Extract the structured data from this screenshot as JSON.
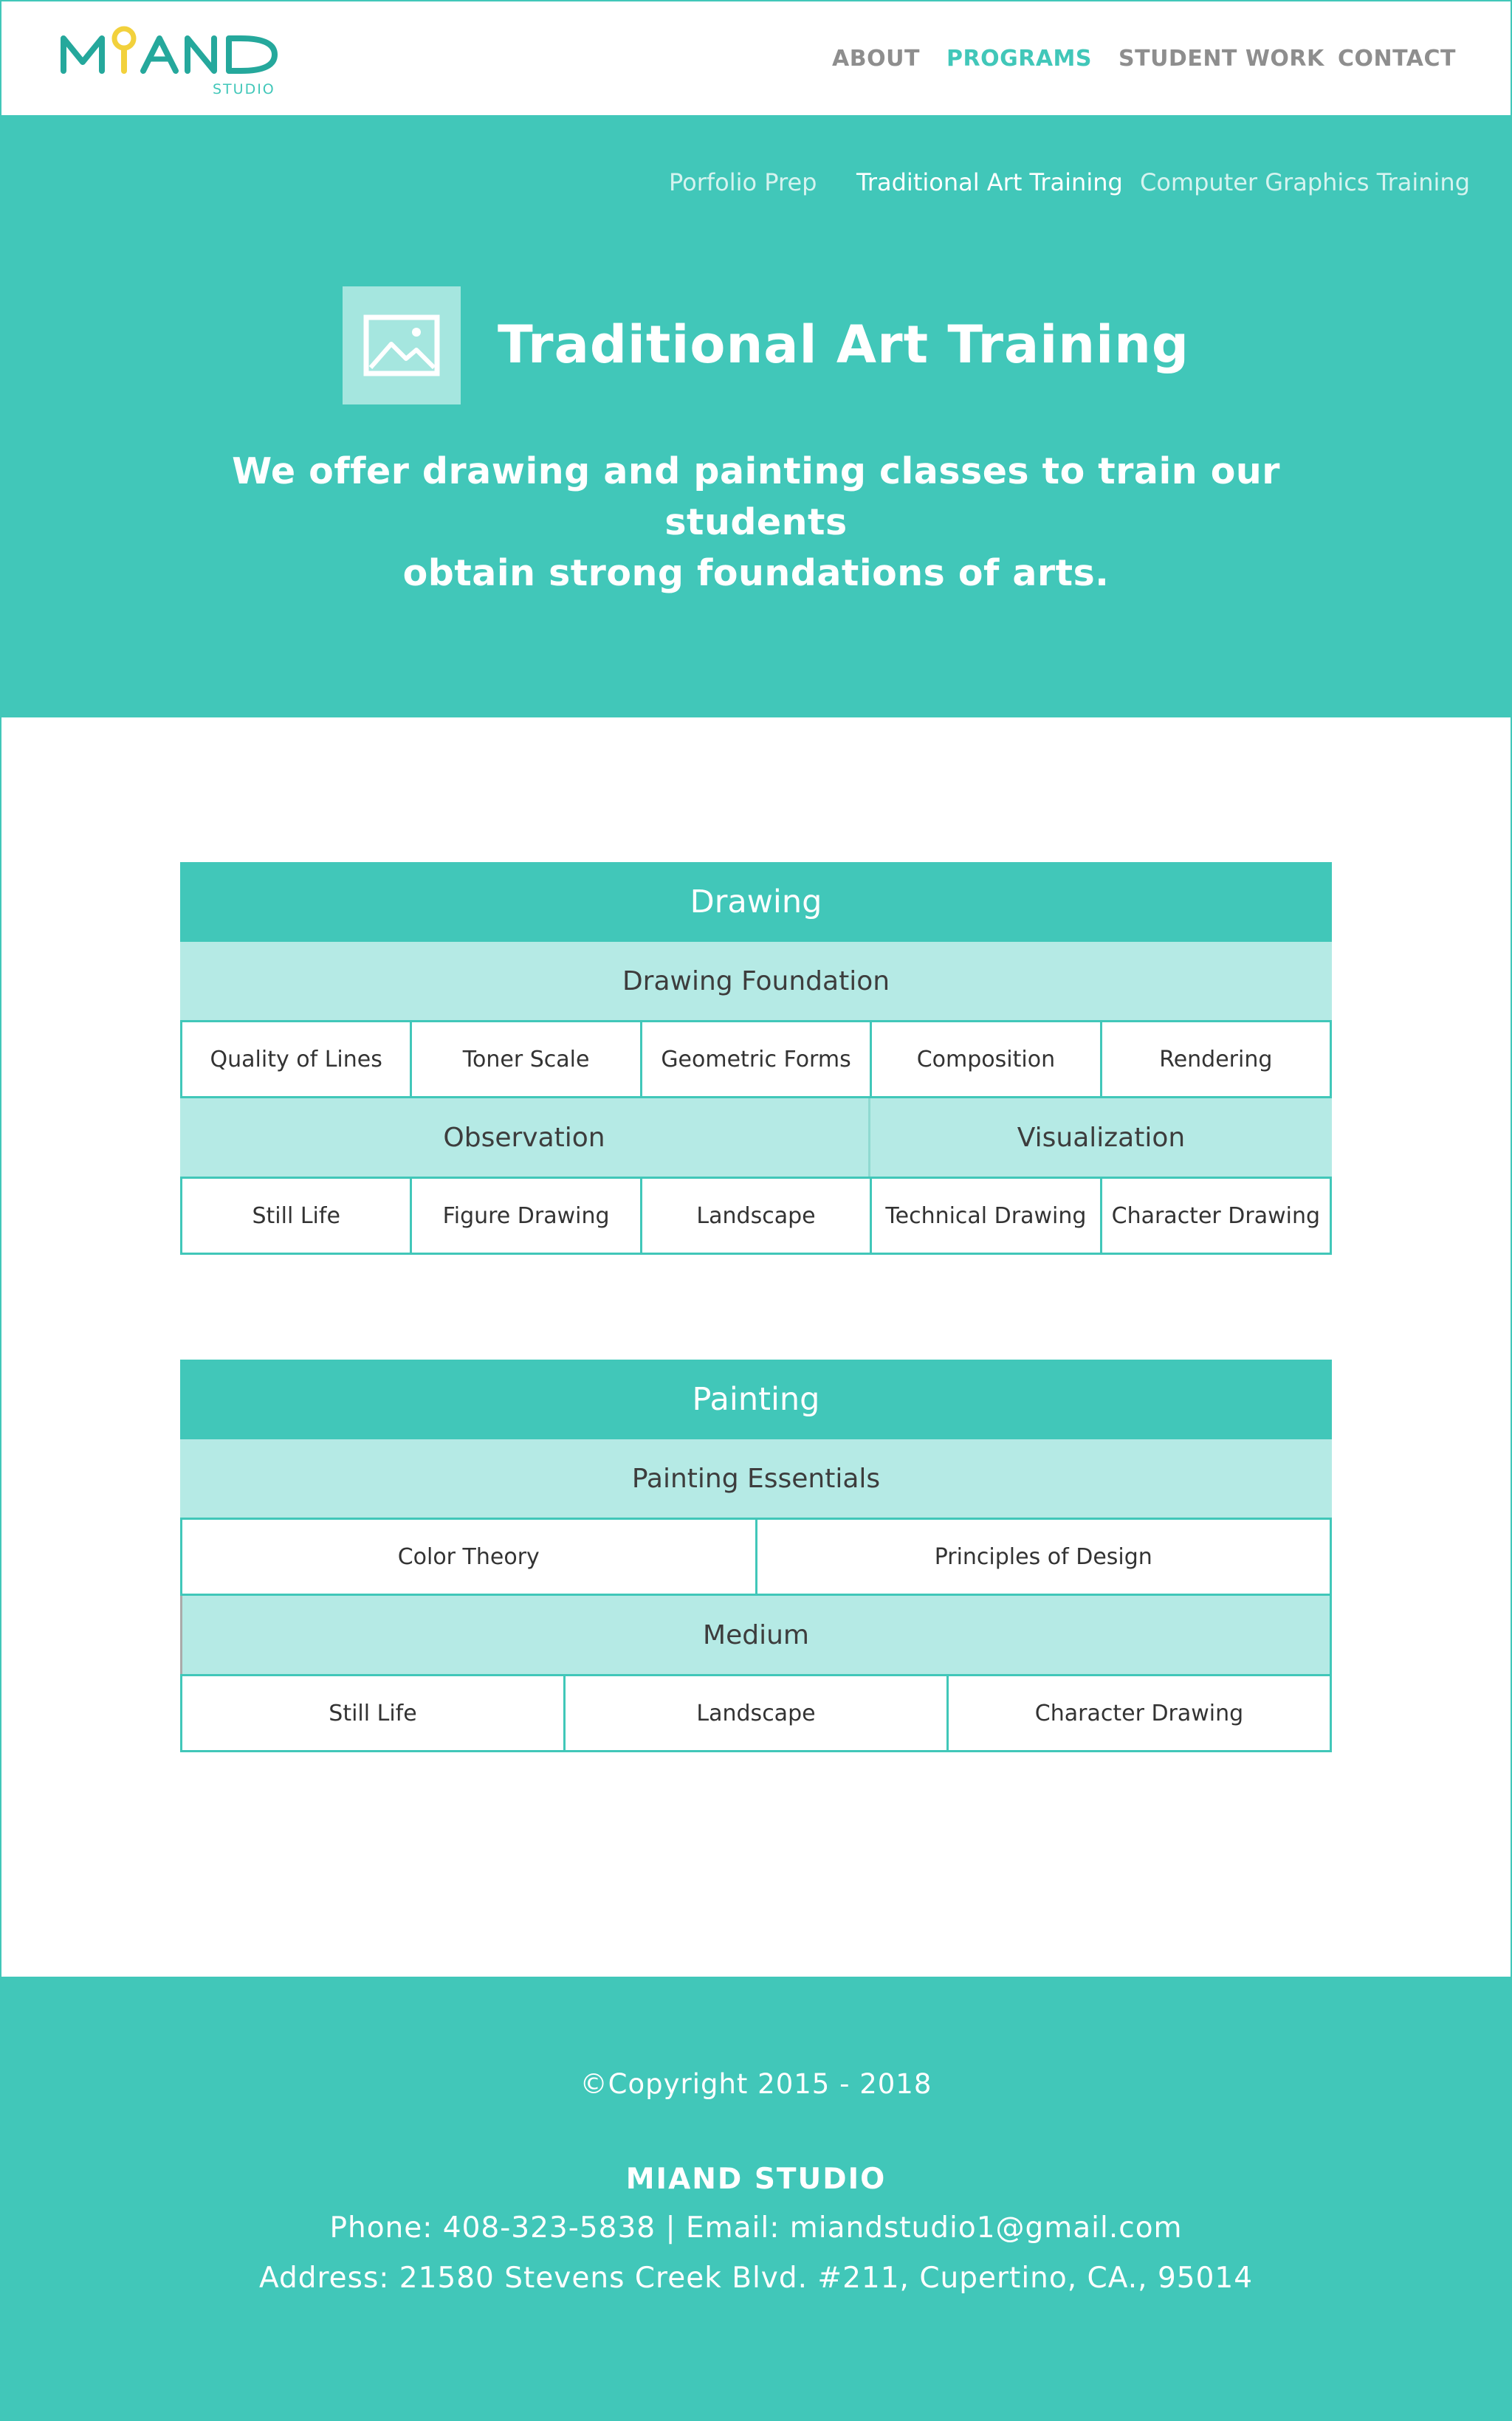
{
  "brand": {
    "logo_text": "MIAND",
    "logo_sub": "STUDIO",
    "colors": {
      "accent": "#41c7b9",
      "light_accent": "#b5eae5",
      "logo_yellow": "#f2d13c",
      "logo_teal": "#25a89c"
    }
  },
  "nav": {
    "items": [
      {
        "label": "ABOUT",
        "active": false
      },
      {
        "label": "PROGRAMS",
        "active": true
      },
      {
        "label": "STUDENT WORK",
        "active": false
      },
      {
        "label": "CONTACT",
        "active": false
      }
    ]
  },
  "hero": {
    "sub_nav": [
      {
        "label": "Porfolio Prep",
        "active": false
      },
      {
        "label": "Traditional Art Training",
        "active": true
      },
      {
        "label": "Computer Graphics Training",
        "active": false
      }
    ],
    "icon": "image-icon",
    "title": "Traditional Art Training",
    "subtitle_line1": "We offer drawing and painting classes to train our students",
    "subtitle_line2": "obtain strong foundations of arts."
  },
  "drawing": {
    "title": "Drawing",
    "foundation_heading": "Drawing Foundation",
    "foundation_items": [
      "Quality of Lines",
      "Toner Scale",
      "Geometric Forms",
      "Composition",
      "Rendering"
    ],
    "observation_heading": "Observation",
    "visualization_heading": "Visualization",
    "observation_items": [
      "Still Life",
      "Figure Drawing",
      "Landscape"
    ],
    "visualization_items": [
      "Technical Drawing",
      "Character Drawing"
    ]
  },
  "painting": {
    "title": "Painting",
    "essentials_heading": "Painting Essentials",
    "essentials_items": [
      "Color Theory",
      "Principles of Design"
    ],
    "medium_heading": "Medium",
    "medium_items": [
      "Still Life",
      "Landscape",
      "Character Drawing"
    ]
  },
  "footer": {
    "copyright": "©Copyright 2015 - 2018",
    "company": "MIAND STUDIO",
    "contact": "Phone: 408-323-5838 | Email: miandstudio1@gmail.com",
    "address": "Address: 21580 Stevens Creek Blvd. #211, Cupertino, CA., 95014"
  }
}
